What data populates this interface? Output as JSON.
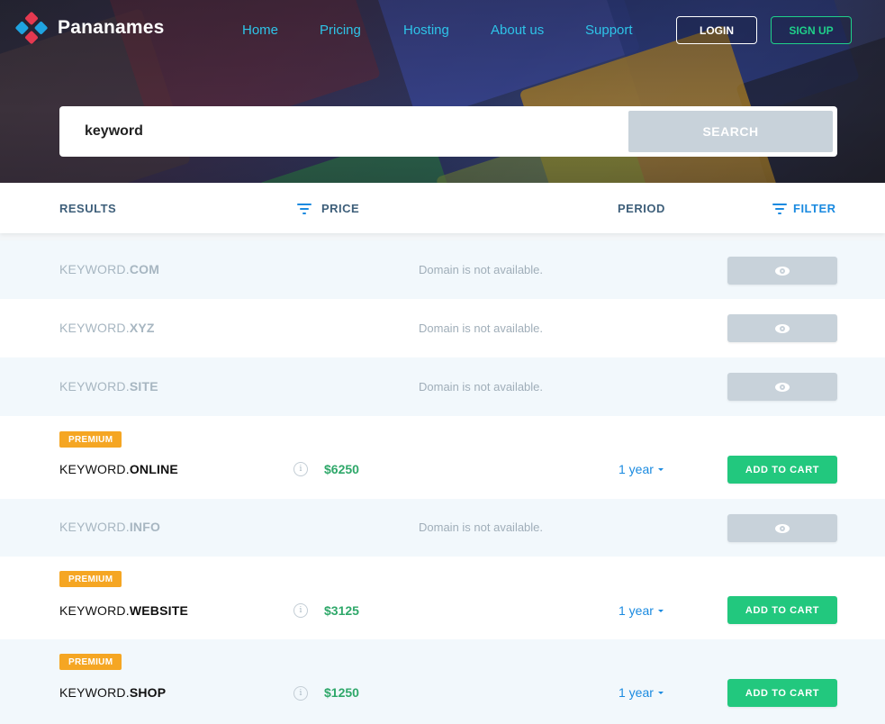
{
  "brand": {
    "name": "Pananames"
  },
  "nav": [
    {
      "label": "Home"
    },
    {
      "label": "Pricing"
    },
    {
      "label": "Hosting"
    },
    {
      "label": "About us"
    },
    {
      "label": "Support"
    }
  ],
  "auth": {
    "login_label": "LOGIN",
    "signup_label": "SIGN UP"
  },
  "search": {
    "value": "keyword",
    "button_label": "SEARCH"
  },
  "table_header": {
    "results": "RESULTS",
    "price": "PRICE",
    "period": "PERIOD",
    "filter": "FILTER"
  },
  "results": [
    {
      "name": "KEYWORD.",
      "tld": "COM",
      "available": false,
      "message": "Domain is not available."
    },
    {
      "name": "KEYWORD.",
      "tld": "XYZ",
      "available": false,
      "message": "Domain is not available."
    },
    {
      "name": "KEYWORD.",
      "tld": "SITE",
      "available": false,
      "message": "Domain is not available."
    },
    {
      "name": "KEYWORD.",
      "tld": "ONLINE",
      "available": true,
      "badge": "PREMIUM",
      "info": "i",
      "price": "$6250",
      "period": "1 year",
      "cart_label": "ADD TO CART"
    },
    {
      "name": "KEYWORD.",
      "tld": "INFO",
      "available": false,
      "message": "Domain is not available."
    },
    {
      "name": "KEYWORD.",
      "tld": "WEBSITE",
      "available": true,
      "badge": "PREMIUM",
      "info": "i",
      "price": "$3125",
      "period": "1 year",
      "cart_label": "ADD TO CART"
    },
    {
      "name": "KEYWORD.",
      "tld": "SHOP",
      "available": true,
      "badge": "PREMIUM",
      "info": "i",
      "price": "$1250",
      "period": "1 year",
      "cart_label": "ADD TO CART"
    }
  ],
  "colors": {
    "accent_blue": "#1a8ae0",
    "nav_cyan": "#2ec4e8",
    "success_green": "#22c87e",
    "price_green": "#2fa86a",
    "premium_orange": "#f5a623",
    "disabled_gray": "#c8d2da"
  },
  "icons": [
    "logo-icon",
    "sort-icon",
    "filter-icon",
    "eye-icon",
    "info-icon",
    "chevron-down-icon"
  ]
}
